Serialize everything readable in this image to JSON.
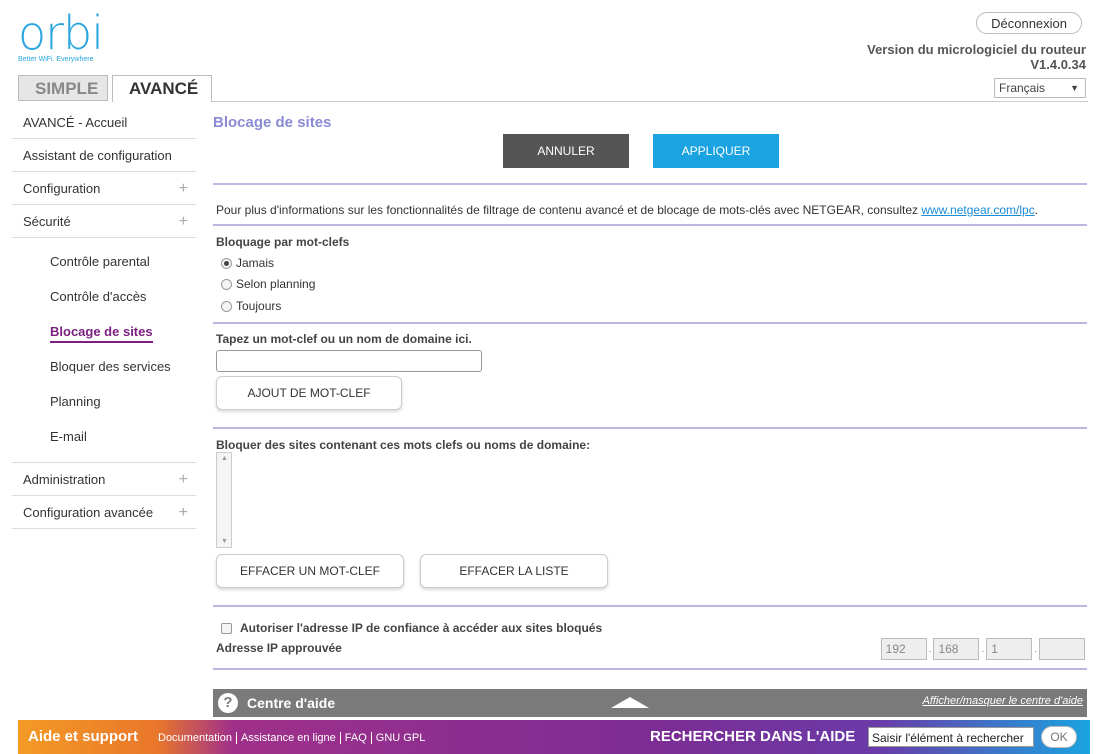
{
  "header": {
    "logo_text": "orbi",
    "logo_tagline": "Better WiFi. Everywhere",
    "logout_label": "Déconnexion",
    "firmware_label": "Version du micrologiciel du routeur",
    "firmware_version": "V1.4.0.34",
    "language": "Français"
  },
  "tabs": [
    {
      "label": "SIMPLE"
    },
    {
      "label": "AVANCÉ"
    }
  ],
  "sidebar": {
    "items": [
      {
        "label": "AVANCÉ - Accueil"
      },
      {
        "label": "Assistant de configuration"
      },
      {
        "label": "Configuration",
        "expand": "+"
      },
      {
        "label": "Sécurité",
        "expand": "+"
      }
    ],
    "sub_items": [
      {
        "label": "Contrôle parental"
      },
      {
        "label": "Contrôle d'accès"
      },
      {
        "label": "Blocage de sites"
      },
      {
        "label": "Bloquer des services"
      },
      {
        "label": "Planning"
      },
      {
        "label": "E-mail"
      }
    ],
    "bottom_items": [
      {
        "label": "Administration",
        "expand": "+"
      },
      {
        "label": "Configuration avancée",
        "expand": "+"
      }
    ]
  },
  "main": {
    "title": "Blocage de sites",
    "cancel_label": "ANNULER",
    "apply_label": "APPLIQUER",
    "info_text": "Pour plus d'informations sur les fonctionnalités de filtrage de contenu avancé et de blocage de mots-clés avec NETGEAR, consultez ",
    "info_link": "www.netgear.com/lpc",
    "info_end": ".",
    "keyword_block_label": "Bloquage par mot-clefs",
    "radio_options": [
      {
        "label": "Jamais",
        "selected": true
      },
      {
        "label": "Selon planning",
        "selected": false
      },
      {
        "label": "Toujours",
        "selected": false
      }
    ],
    "keyword_input_label": "Tapez un mot-clef ou un nom de domaine ici.",
    "keyword_input_value": "",
    "add_keyword_label": "AJOUT DE MOT-CLEF",
    "block_list_label": "Bloquer des sites contenant ces mots clefs ou noms de domaine:",
    "delete_keyword_label": "EFFACER UN MOT-CLEF",
    "clear_list_label": "EFFACER LA LISTE",
    "trusted_ip_checkbox_label": "Autoriser l'adresse IP de confiance à accéder aux sites bloqués",
    "trusted_ip_checked": false,
    "approved_ip_label": "Adresse IP approuvée",
    "ip_octets": [
      "192",
      "168",
      "1",
      ""
    ]
  },
  "help": {
    "icon": "?",
    "title": "Centre d'aide",
    "toggle_label": "Afficher/masquer le centre d'aide"
  },
  "footer": {
    "title": "Aide et support",
    "links": [
      "Documentation",
      "Assistance en ligne",
      "FAQ",
      "GNU GPL"
    ],
    "search_label": "RECHERCHER DANS L'AIDE",
    "search_placeholder": "Saisir l'élément à rechercher",
    "ok_label": "OK"
  },
  "colors": {
    "accent_blue": "#1aa3e0",
    "title_purple": "#8a8ad6",
    "active_purple": "#7a1f7f",
    "help_gray": "#7a7a7a"
  }
}
